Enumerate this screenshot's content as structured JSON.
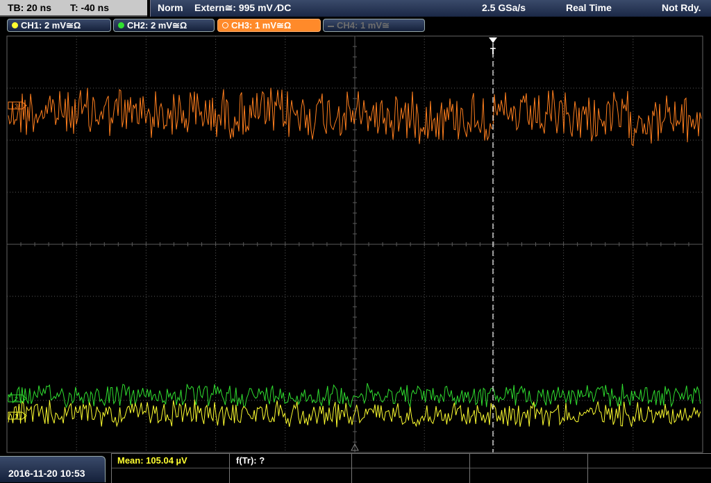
{
  "header": {
    "timebase": "TB: 20 ns",
    "trigger_time": "T: -40 ns",
    "trigger_mode": "Norm",
    "trigger_source": "Extern≅: 995 mV ⁄DC",
    "sample_rate": "2.5 GSa/s",
    "acq_mode": "Real Time",
    "status": "Not Rdy."
  },
  "channels": [
    {
      "label": "CH1: 2 mV≅Ω",
      "color": "#ffff30",
      "state": "on"
    },
    {
      "label": "CH2: 2 mV≅Ω",
      "color": "#30e030",
      "state": "on"
    },
    {
      "label": "CH3: 1 mV≅Ω",
      "color": "#ff7f1e",
      "state": "active"
    },
    {
      "label": "CH4: 1 mV≅",
      "color": "#6d6d6d",
      "state": "off"
    }
  ],
  "trigger_marker": "T",
  "markers": {
    "ch1": "1",
    "ch2": "2",
    "ch3": "3"
  },
  "footer": {
    "datetime": "2016-11-20 10:53",
    "mean": "Mean: 105.04 µV",
    "f_tr": "f(Tr): ?"
  },
  "colors": {
    "ch1": "#ffff30",
    "ch2": "#30e030",
    "ch3": "#ff7f1e",
    "grid": "#5a5a5a",
    "trigger": "#ffffff"
  }
}
